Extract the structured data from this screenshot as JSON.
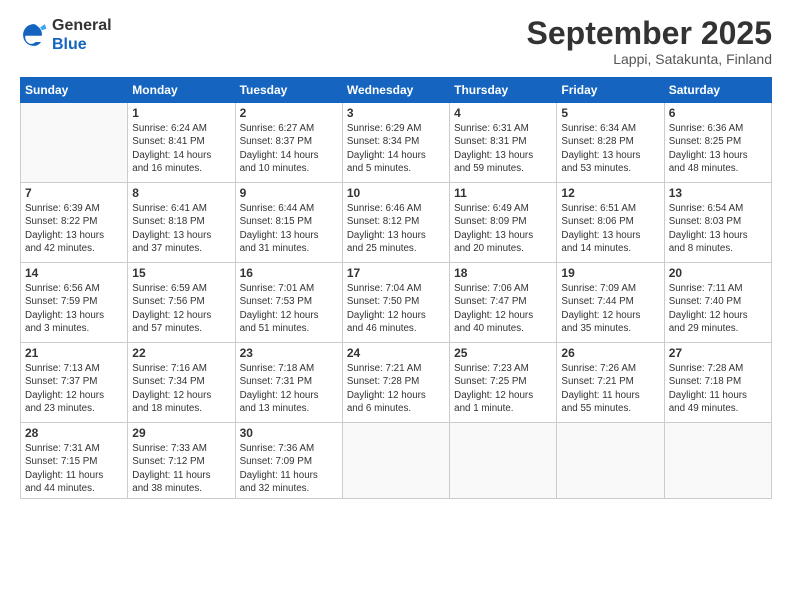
{
  "logo": {
    "general": "General",
    "blue": "Blue"
  },
  "header": {
    "month": "September 2025",
    "location": "Lappi, Satakunta, Finland"
  },
  "weekdays": [
    "Sunday",
    "Monday",
    "Tuesday",
    "Wednesday",
    "Thursday",
    "Friday",
    "Saturday"
  ],
  "weeks": [
    [
      {
        "day": "",
        "info": ""
      },
      {
        "day": "1",
        "info": "Sunrise: 6:24 AM\nSunset: 8:41 PM\nDaylight: 14 hours\nand 16 minutes."
      },
      {
        "day": "2",
        "info": "Sunrise: 6:27 AM\nSunset: 8:37 PM\nDaylight: 14 hours\nand 10 minutes."
      },
      {
        "day": "3",
        "info": "Sunrise: 6:29 AM\nSunset: 8:34 PM\nDaylight: 14 hours\nand 5 minutes."
      },
      {
        "day": "4",
        "info": "Sunrise: 6:31 AM\nSunset: 8:31 PM\nDaylight: 13 hours\nand 59 minutes."
      },
      {
        "day": "5",
        "info": "Sunrise: 6:34 AM\nSunset: 8:28 PM\nDaylight: 13 hours\nand 53 minutes."
      },
      {
        "day": "6",
        "info": "Sunrise: 6:36 AM\nSunset: 8:25 PM\nDaylight: 13 hours\nand 48 minutes."
      }
    ],
    [
      {
        "day": "7",
        "info": "Sunrise: 6:39 AM\nSunset: 8:22 PM\nDaylight: 13 hours\nand 42 minutes."
      },
      {
        "day": "8",
        "info": "Sunrise: 6:41 AM\nSunset: 8:18 PM\nDaylight: 13 hours\nand 37 minutes."
      },
      {
        "day": "9",
        "info": "Sunrise: 6:44 AM\nSunset: 8:15 PM\nDaylight: 13 hours\nand 31 minutes."
      },
      {
        "day": "10",
        "info": "Sunrise: 6:46 AM\nSunset: 8:12 PM\nDaylight: 13 hours\nand 25 minutes."
      },
      {
        "day": "11",
        "info": "Sunrise: 6:49 AM\nSunset: 8:09 PM\nDaylight: 13 hours\nand 20 minutes."
      },
      {
        "day": "12",
        "info": "Sunrise: 6:51 AM\nSunset: 8:06 PM\nDaylight: 13 hours\nand 14 minutes."
      },
      {
        "day": "13",
        "info": "Sunrise: 6:54 AM\nSunset: 8:03 PM\nDaylight: 13 hours\nand 8 minutes."
      }
    ],
    [
      {
        "day": "14",
        "info": "Sunrise: 6:56 AM\nSunset: 7:59 PM\nDaylight: 13 hours\nand 3 minutes."
      },
      {
        "day": "15",
        "info": "Sunrise: 6:59 AM\nSunset: 7:56 PM\nDaylight: 12 hours\nand 57 minutes."
      },
      {
        "day": "16",
        "info": "Sunrise: 7:01 AM\nSunset: 7:53 PM\nDaylight: 12 hours\nand 51 minutes."
      },
      {
        "day": "17",
        "info": "Sunrise: 7:04 AM\nSunset: 7:50 PM\nDaylight: 12 hours\nand 46 minutes."
      },
      {
        "day": "18",
        "info": "Sunrise: 7:06 AM\nSunset: 7:47 PM\nDaylight: 12 hours\nand 40 minutes."
      },
      {
        "day": "19",
        "info": "Sunrise: 7:09 AM\nSunset: 7:44 PM\nDaylight: 12 hours\nand 35 minutes."
      },
      {
        "day": "20",
        "info": "Sunrise: 7:11 AM\nSunset: 7:40 PM\nDaylight: 12 hours\nand 29 minutes."
      }
    ],
    [
      {
        "day": "21",
        "info": "Sunrise: 7:13 AM\nSunset: 7:37 PM\nDaylight: 12 hours\nand 23 minutes."
      },
      {
        "day": "22",
        "info": "Sunrise: 7:16 AM\nSunset: 7:34 PM\nDaylight: 12 hours\nand 18 minutes."
      },
      {
        "day": "23",
        "info": "Sunrise: 7:18 AM\nSunset: 7:31 PM\nDaylight: 12 hours\nand 13 minutes."
      },
      {
        "day": "24",
        "info": "Sunrise: 7:21 AM\nSunset: 7:28 PM\nDaylight: 12 hours\nand 6 minutes."
      },
      {
        "day": "25",
        "info": "Sunrise: 7:23 AM\nSunset: 7:25 PM\nDaylight: 12 hours\nand 1 minute."
      },
      {
        "day": "26",
        "info": "Sunrise: 7:26 AM\nSunset: 7:21 PM\nDaylight: 11 hours\nand 55 minutes."
      },
      {
        "day": "27",
        "info": "Sunrise: 7:28 AM\nSunset: 7:18 PM\nDaylight: 11 hours\nand 49 minutes."
      }
    ],
    [
      {
        "day": "28",
        "info": "Sunrise: 7:31 AM\nSunset: 7:15 PM\nDaylight: 11 hours\nand 44 minutes."
      },
      {
        "day": "29",
        "info": "Sunrise: 7:33 AM\nSunset: 7:12 PM\nDaylight: 11 hours\nand 38 minutes."
      },
      {
        "day": "30",
        "info": "Sunrise: 7:36 AM\nSunset: 7:09 PM\nDaylight: 11 hours\nand 32 minutes."
      },
      {
        "day": "",
        "info": ""
      },
      {
        "day": "",
        "info": ""
      },
      {
        "day": "",
        "info": ""
      },
      {
        "day": "",
        "info": ""
      }
    ]
  ]
}
